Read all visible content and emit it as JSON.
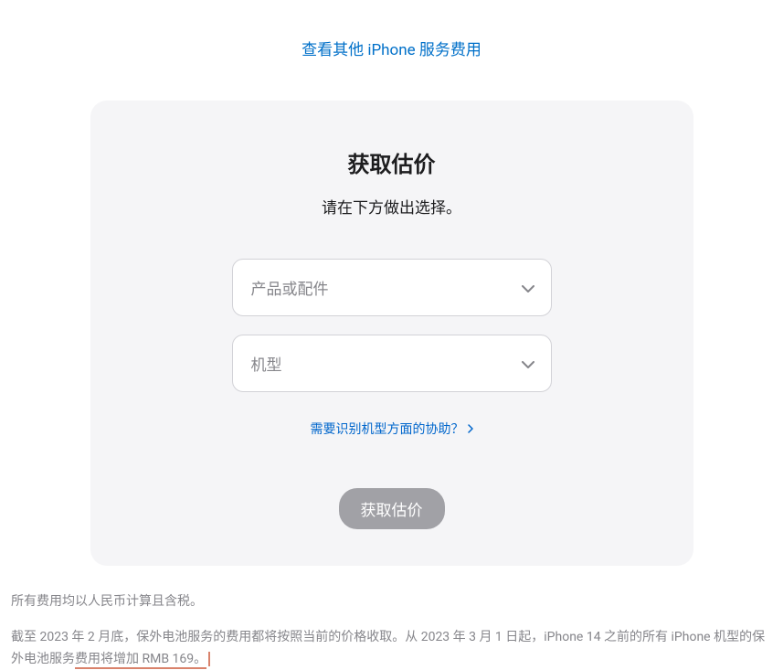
{
  "topLink": "查看其他 iPhone 服务费用",
  "card": {
    "title": "获取估价",
    "subtitle": "请在下方做出选择。",
    "select1Placeholder": "产品或配件",
    "select2Placeholder": "机型",
    "helpLink": "需要识别机型方面的协助？",
    "submitLabel": "获取估价"
  },
  "footer": {
    "line1": "所有费用均以人民币计算且含税。",
    "line2_a": "截至 2023 年 2 月底，保外电池服务的费用都将按照当前的价格收取。从 2023 年 3 月 1 日起，iPhone 14 之前的所有 iPhone 机型的保外电池服务",
    "line2_b": "费用将增加 RMB 169。"
  }
}
